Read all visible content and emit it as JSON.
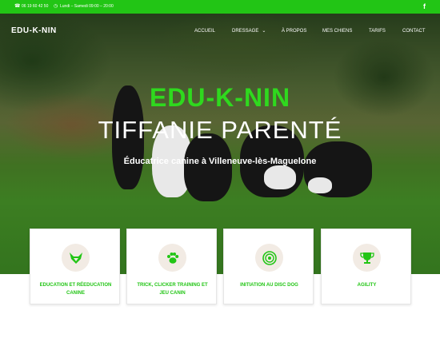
{
  "topbar": {
    "phone": "06 19 60 42 50",
    "hours": "Lundi – Samedi 09:00 – 20:00",
    "phone_icon": "phone-icon",
    "clock_icon": "clock-icon",
    "facebook_label": "f"
  },
  "brand": "EDU-K-NIN",
  "nav": [
    {
      "label": "ACCUEIL"
    },
    {
      "label": "DRESSAGE"
    },
    {
      "label": "À PROPOS"
    },
    {
      "label": "MES CHIENS"
    },
    {
      "label": "TARIFS"
    },
    {
      "label": "CONTACT"
    }
  ],
  "hero": {
    "title": "EDU-K-NIN",
    "name": "TIFFANIE PARENTÉ",
    "subtitle": "Éducatrice canine à Villeneuve-lès-Maguelone"
  },
  "services": [
    {
      "label": "EDUCATION ET RÉEDUCATION CANINE",
      "icon": "fox-icon"
    },
    {
      "label": "TRICK, CLICKER TRAINING ET JEU CANIN",
      "icon": "paw-icon"
    },
    {
      "label": "INITIATION AU DISC DOG",
      "icon": "disc-icon"
    },
    {
      "label": "AGILITY",
      "icon": "trophy-icon"
    }
  ],
  "colors": {
    "accent": "#22c515",
    "title_green": "#2fd91e",
    "icon_bg": "#f2ebe4"
  }
}
